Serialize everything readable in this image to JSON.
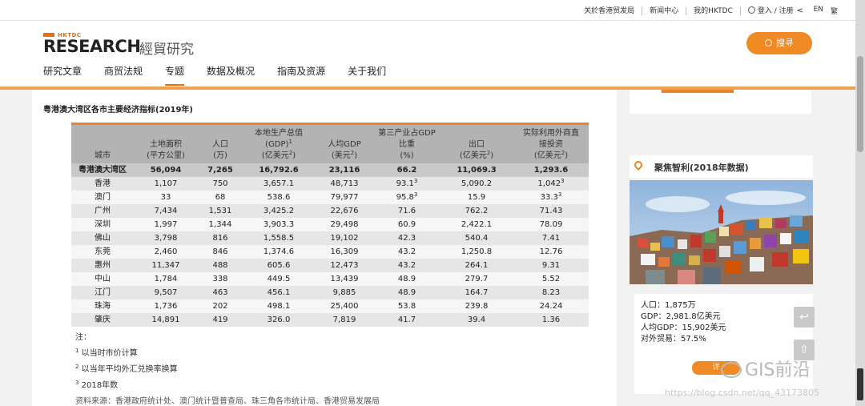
{
  "topbar": {
    "links": [
      "关於香港贸发局",
      "新闻中心",
      "我的HKTDC",
      "登入 / 注册"
    ],
    "lang_en": "EN",
    "lang_fan": "繁"
  },
  "header": {
    "logo_small": "HKTDC",
    "logo": "RESEARCH",
    "logo_cn": "經貿研究",
    "search_label": "搜寻",
    "nav": [
      "研究文章",
      "商贸法规",
      "专题",
      "数据及概况",
      "指南及资源",
      "关于我们"
    ],
    "active_nav": "专题"
  },
  "table": {
    "title": "粤港澳大湾区各市主要经济指标(2019年)",
    "columns": [
      {
        "lines": [
          "城市"
        ]
      },
      {
        "lines": [
          "土地面积",
          "(平方公里)"
        ]
      },
      {
        "lines": [
          "人口",
          "(万)"
        ]
      },
      {
        "lines": [
          "本地生产总值",
          "(GDP)¹",
          "(亿美元²)"
        ]
      },
      {
        "lines": [
          "人均GDP",
          "(美元²)"
        ]
      },
      {
        "lines": [
          "第三产业占GDP",
          "比重",
          "(%)"
        ]
      },
      {
        "lines": [
          "出口",
          "(亿美元²)"
        ]
      },
      {
        "lines": [
          "实际利用外商直",
          "接投资",
          "(亿美元²)"
        ]
      }
    ],
    "rows": [
      [
        "粤港澳大湾区",
        "56,094",
        "7,265",
        "16,792.6",
        "23,116",
        "66.2",
        "11,069.3",
        "1,293.6"
      ],
      [
        "香港",
        "1,107",
        "750",
        "3,657.1",
        "48,713",
        "93.1³",
        "5,090.2",
        "1,042³"
      ],
      [
        "澳门",
        "33",
        "68",
        "538.6",
        "79,977",
        "95.8³",
        "15.9",
        "33.3³"
      ],
      [
        "广州",
        "7,434",
        "1,531",
        "3,425.2",
        "22,676",
        "71.6",
        "762.2",
        "71.43"
      ],
      [
        "深圳",
        "1,997",
        "1,344",
        "3,903.3",
        "29,498",
        "60.9",
        "2,422.1",
        "78.09"
      ],
      [
        "佛山",
        "3,798",
        "816",
        "1,558.5",
        "19,102",
        "42.3",
        "540.4",
        "7.41"
      ],
      [
        "东莞",
        "2,460",
        "846",
        "1,374.6",
        "16,309",
        "43.2",
        "1,250.8",
        "12.76"
      ],
      [
        "惠州",
        "11,347",
        "488",
        "605.6",
        "12,473",
        "43.2",
        "264.1",
        "9.31"
      ],
      [
        "中山",
        "1,784",
        "338",
        "449.5",
        "13,439",
        "48.9",
        "279.7",
        "5.52"
      ],
      [
        "江门",
        "9,507",
        "463",
        "456.1",
        "9,885",
        "48.9",
        "164.7",
        "8.23"
      ],
      [
        "珠海",
        "1,736",
        "202",
        "498.1",
        "25,400",
        "53.8",
        "239.8",
        "24.24"
      ],
      [
        "肇庆",
        "14,891",
        "419",
        "326.0",
        "7,819",
        "41.7",
        "39.4",
        "1.36"
      ]
    ],
    "notes_title": "注：",
    "notes": [
      "以当时市价计算",
      "以当年平均外汇兑换率换算",
      "2018年数"
    ],
    "source": "资料来源：香港政府统计处、澳门统计暨普查局、珠三角各市统计局、香港贸易发展局"
  },
  "side": {
    "title": "聚焦智利(2018年数据)",
    "info": [
      "人口：1,875万",
      "GDP：2,981.8亿美元",
      "人均GDP：15,902美元",
      "对外贸易：57.5%"
    ],
    "more_label": "详"
  },
  "watermark": {
    "brand": "GIS前沿",
    "url": "https://blog.csdn.net/qq_43173805"
  },
  "colors": {
    "accent": "#e8852a",
    "button": "#f08a24",
    "header_bg": "#b3b3b3"
  }
}
